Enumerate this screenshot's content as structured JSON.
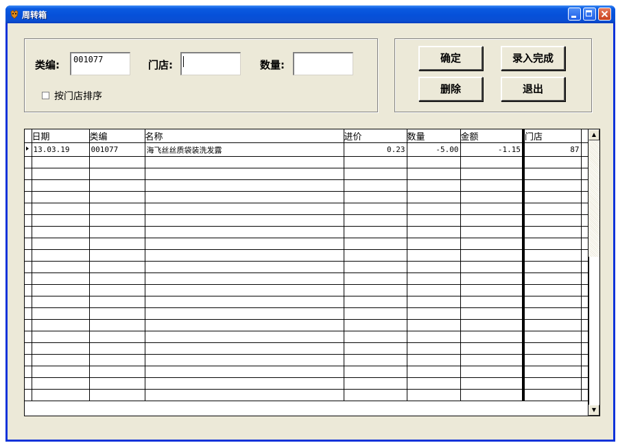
{
  "window": {
    "title": "周转箱"
  },
  "form": {
    "category_label": "类编:",
    "category_value": "001077",
    "store_label": "门店:",
    "store_value": "",
    "quantity_label": "数量:",
    "quantity_value": "",
    "sort_checkbox_label": "按门店排序",
    "sort_checked": false
  },
  "buttons": {
    "confirm": "确定",
    "finish": "录入完成",
    "delete": "删除",
    "exit": "退出"
  },
  "table": {
    "columns": [
      "日期",
      "类编",
      "名称",
      "进价",
      "数量",
      "金额",
      "门店"
    ],
    "rows": [
      [
        "13.03.19",
        "001077",
        "海飞丝丝质袋装洗发露",
        "0.23",
        "-5.00",
        "-1.15",
        "87"
      ]
    ],
    "empty_rows": 21
  },
  "colors": {
    "title_bar": "#0a5ae0",
    "client": "#ece9d8"
  }
}
